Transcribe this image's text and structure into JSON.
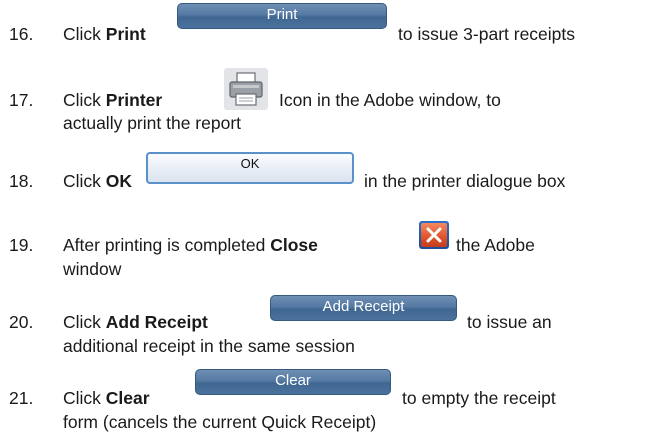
{
  "steps": [
    {
      "number": "16.",
      "pre": "Click ",
      "bold": "Print",
      "post": "to issue 3-part receipts",
      "button_label": "Print"
    },
    {
      "number": "17.",
      "pre": "Click ",
      "bold": "Printer",
      "post": "Icon in the Adobe window, to",
      "line2": "actually print the report",
      "icon": "printer-icon"
    },
    {
      "number": "18.",
      "pre": "Click ",
      "bold": "OK",
      "post": "in the printer dialogue box",
      "button_label": "OK"
    },
    {
      "number": "19.",
      "pre": "After printing is completed ",
      "bold": "Close",
      "post": "the Adobe",
      "line2": "window",
      "icon": "close-icon"
    },
    {
      "number": "20.",
      "pre": "Click ",
      "bold": "Add Receipt",
      "post": "to issue an",
      "line2": "additional receipt in the same session",
      "button_label": "Add Receipt"
    },
    {
      "number": "21.",
      "pre": "Click ",
      "bold": "Clear",
      "post": "to empty the receipt",
      "line2": "form (cancels the current Quick Receipt)",
      "button_label": "Clear"
    }
  ],
  "colors": {
    "button_blue": "#4b729c",
    "ok_border": "#5b91c9",
    "close_red": "#e0522c",
    "text": "#1a1a1a"
  }
}
